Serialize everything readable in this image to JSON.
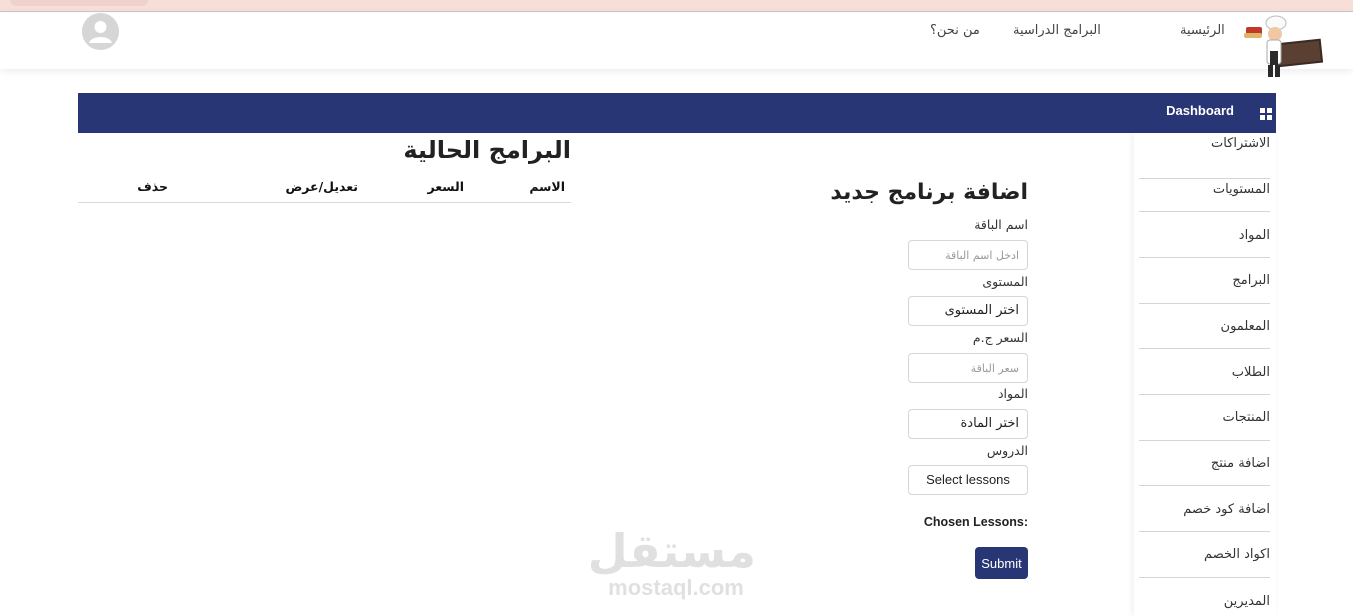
{
  "nav": {
    "home": "الرئيسية",
    "programs": "البرامج الدراسية",
    "about": "من نحن؟"
  },
  "dashboard": {
    "title": "Dashboard",
    "icon": "grid-icon",
    "bar_color": "#283676"
  },
  "sidebar": {
    "items": [
      {
        "label": "الاشتراكات"
      },
      {
        "label": "المستويات"
      },
      {
        "label": "المواد"
      },
      {
        "label": "البرامج"
      },
      {
        "label": "المعلمون"
      },
      {
        "label": "الطلاب"
      },
      {
        "label": "المنتجات"
      },
      {
        "label": "اضافة منتج"
      },
      {
        "label": "اضافة كود خصم"
      },
      {
        "label": "اكواد الخصم"
      },
      {
        "label": "المديرين"
      }
    ]
  },
  "form": {
    "title": "اضافة برنامج جديد",
    "package_name": {
      "label": "اسم الباقة",
      "placeholder": "ادخل اسم الباقة",
      "value": ""
    },
    "level": {
      "label": "المستوى",
      "selected": "اختر المستوى"
    },
    "price": {
      "label": "السعر ج.م",
      "placeholder": "سعر الباقة",
      "value": ""
    },
    "subject": {
      "label": "المواد",
      "selected": "اختر المادة"
    },
    "lessons": {
      "label": "الدروس",
      "selected": "Select lessons"
    },
    "chosen_lessons": "Chosen Lessons:",
    "submit": "Submit"
  },
  "programs": {
    "title": "البرامج الحالية",
    "columns": [
      "الاسم",
      "السعر",
      "تعديل/عرض",
      "حذف"
    ],
    "rows": []
  },
  "watermark": {
    "arabic": "مستقل",
    "latin": "mostaql.com"
  },
  "colors": {
    "primary": "#283676",
    "top_strip": "#f7dfd8"
  }
}
